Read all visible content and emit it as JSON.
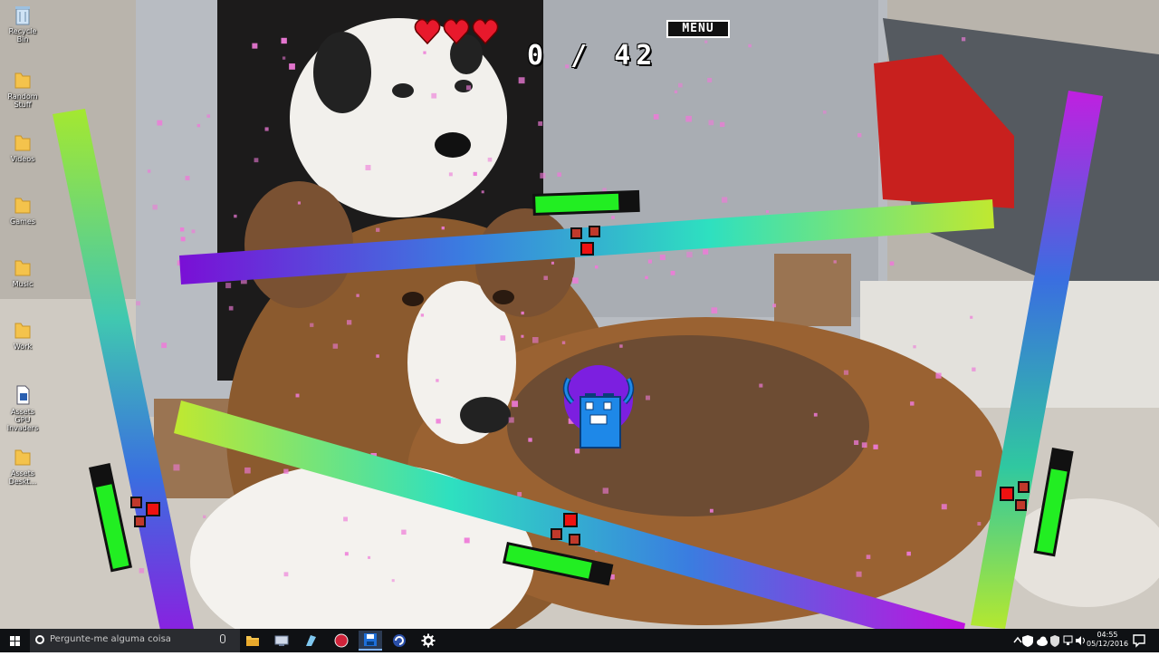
{
  "desktop": {
    "icons": [
      {
        "label": "Recycle Bin",
        "icon": "recycle-bin-icon"
      },
      {
        "label": "Random Stuff",
        "icon": "folder-icon"
      },
      {
        "label": "Videos",
        "icon": "folder-icon"
      },
      {
        "label": "Games",
        "icon": "folder-icon"
      },
      {
        "label": "Music",
        "icon": "folder-icon"
      },
      {
        "label": "Work",
        "icon": "folder-icon"
      },
      {
        "label": "Assets GPU Invaders",
        "icon": "file-icon"
      },
      {
        "label": "Assets Deskt...",
        "icon": "folder-icon"
      }
    ]
  },
  "game": {
    "hud": {
      "hearts": 3,
      "heart_color": "#e8192c",
      "score": "0 / 42",
      "menu_label": "MENU"
    },
    "health_bar_fill": 0.82,
    "health_bar_color": "#22ee22",
    "bar_gradient_colors": [
      "#7a0fd6",
      "#3a7de0",
      "#2ee0c0",
      "#c0e830"
    ],
    "player_colors": {
      "head": "#7c1fe0",
      "body": "#1e88e8"
    }
  },
  "taskbar": {
    "search_placeholder": "Pergunte-me alguma coisa",
    "apps": [
      {
        "name": "file-explorer-icon"
      },
      {
        "name": "network-app-icon"
      },
      {
        "name": "notepad-icon"
      },
      {
        "name": "record-app-icon"
      },
      {
        "name": "save-app-icon"
      },
      {
        "name": "refresh-app-icon"
      },
      {
        "name": "settings-icon"
      }
    ],
    "time": "04:55",
    "date": "05/12/2016"
  }
}
